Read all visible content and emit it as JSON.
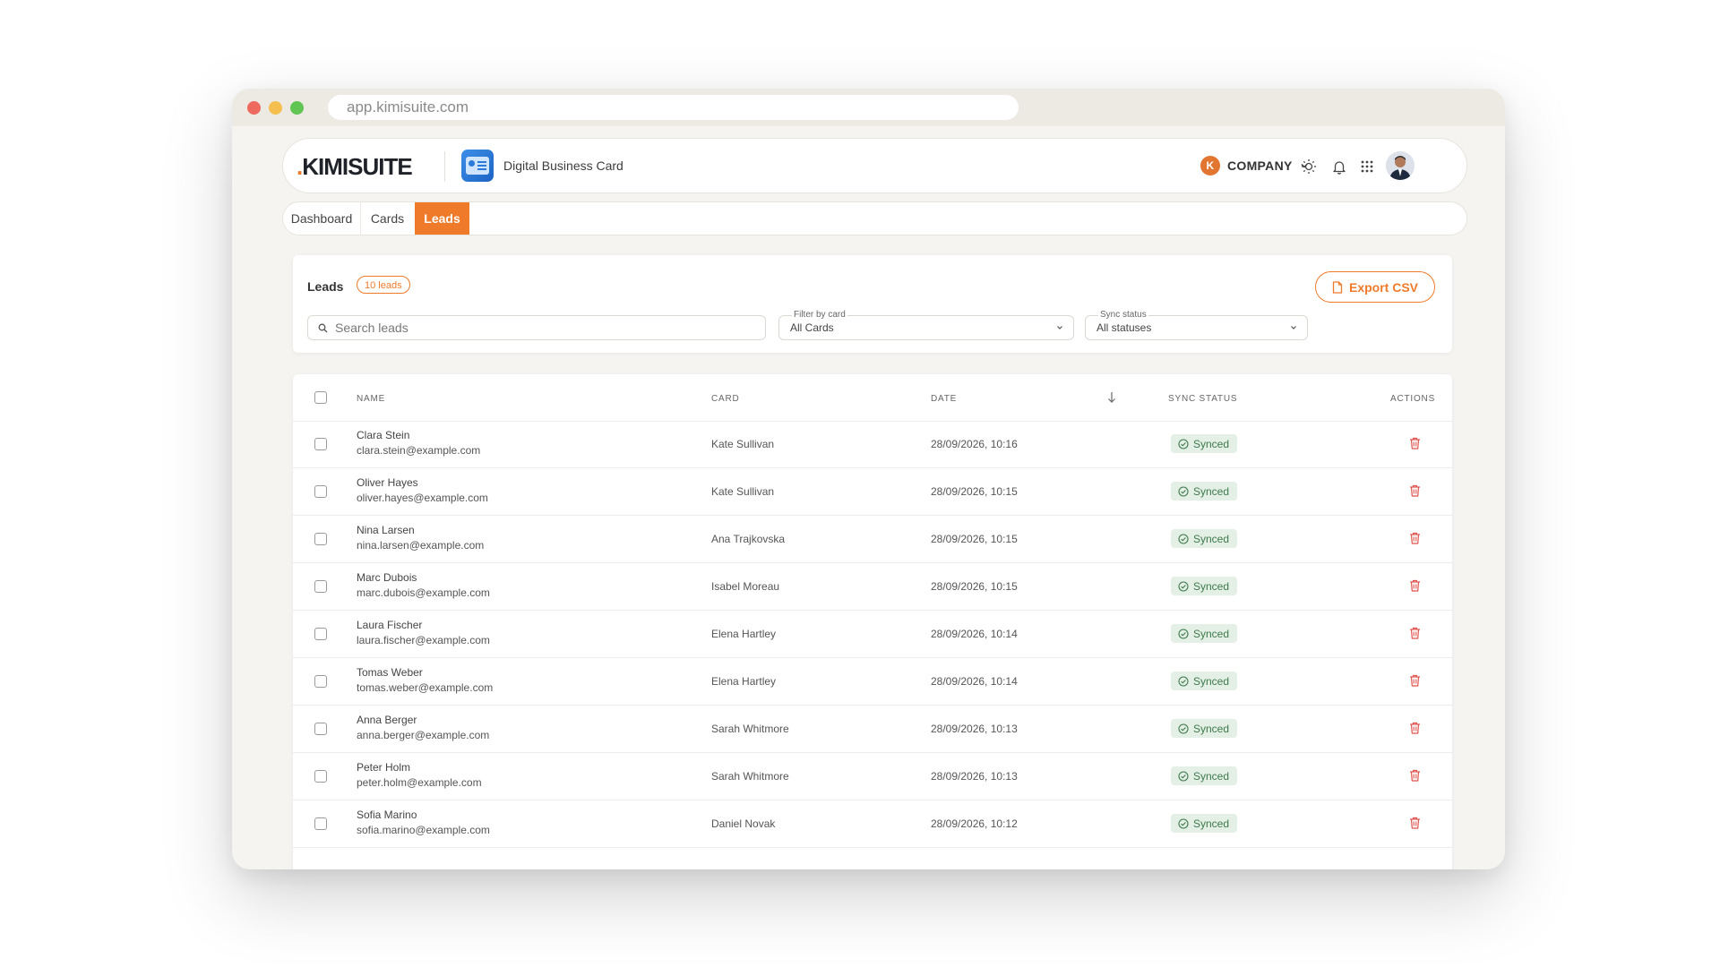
{
  "browser": {
    "url": "app.kimisuite.com"
  },
  "header": {
    "logo": "KIMISUITE",
    "logo_dot": ".",
    "app_name": "Digital Business Card",
    "company": {
      "initial": "K",
      "label": "COMPANY"
    }
  },
  "tabs": [
    {
      "label": "Dashboard",
      "active": false
    },
    {
      "label": "Cards",
      "active": false
    },
    {
      "label": "Leads",
      "active": true
    }
  ],
  "leads_panel": {
    "title": "Leads",
    "count_badge": "10 leads",
    "export_label": "Export CSV",
    "search_placeholder": "Search leads",
    "filter_card": {
      "label": "Filter by card",
      "value": "All Cards"
    },
    "sync_status": {
      "label": "Sync status",
      "value": "All statuses"
    }
  },
  "table": {
    "columns": {
      "name": "NAME",
      "card": "CARD",
      "date": "DATE",
      "sync": "SYNC STATUS",
      "actions": "ACTIONS"
    },
    "rows": [
      {
        "name": "Clara Stein",
        "email": "clara.stein@example.com",
        "card": "Kate Sullivan",
        "date": "28/09/2026, 10:16",
        "status": "Synced"
      },
      {
        "name": "Oliver Hayes",
        "email": "oliver.hayes@example.com",
        "card": "Kate Sullivan",
        "date": "28/09/2026, 10:15",
        "status": "Synced"
      },
      {
        "name": "Nina Larsen",
        "email": "nina.larsen@example.com",
        "card": "Ana Trajkovska",
        "date": "28/09/2026, 10:15",
        "status": "Synced"
      },
      {
        "name": "Marc Dubois",
        "email": "marc.dubois@example.com",
        "card": "Isabel Moreau",
        "date": "28/09/2026, 10:15",
        "status": "Synced"
      },
      {
        "name": "Laura Fischer",
        "email": "laura.fischer@example.com",
        "card": "Elena Hartley",
        "date": "28/09/2026, 10:14",
        "status": "Synced"
      },
      {
        "name": "Tomas Weber",
        "email": "tomas.weber@example.com",
        "card": "Elena Hartley",
        "date": "28/09/2026, 10:14",
        "status": "Synced"
      },
      {
        "name": "Anna Berger",
        "email": "anna.berger@example.com",
        "card": "Sarah Whitmore",
        "date": "28/09/2026, 10:13",
        "status": "Synced"
      },
      {
        "name": "Peter Holm",
        "email": "peter.holm@example.com",
        "card": "Sarah Whitmore",
        "date": "28/09/2026, 10:13",
        "status": "Synced"
      },
      {
        "name": "Sofia Marino",
        "email": "sofia.marino@example.com",
        "card": "Daniel Novak",
        "date": "28/09/2026, 10:12",
        "status": "Synced"
      }
    ]
  },
  "colors": {
    "accent": "#ef7a2a",
    "synced_bg": "#e4efe6",
    "synced_text": "#3d7a4c",
    "delete": "#e0524c"
  }
}
